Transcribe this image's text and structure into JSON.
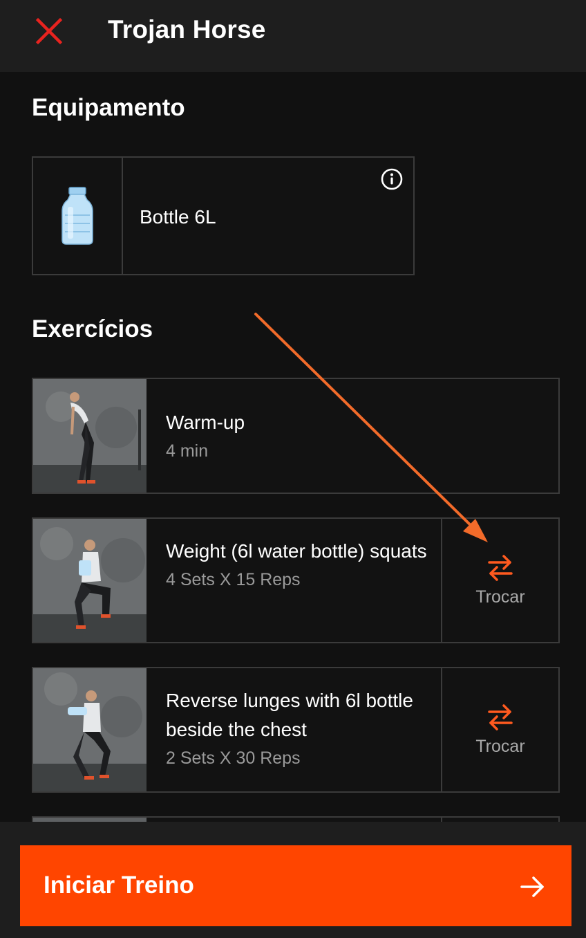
{
  "header": {
    "title": "Trojan Horse",
    "close_icon": "close-icon"
  },
  "equipment": {
    "section_title": "Equipamento",
    "items": [
      {
        "name": "Bottle 6L",
        "image": "water-bottle-image",
        "info_icon": "info-icon"
      }
    ]
  },
  "exercises": {
    "section_title": "Exercícios",
    "items": [
      {
        "name": "Warm-up",
        "meta": "4 min",
        "image": "warm-up-photo"
      },
      {
        "name": "Weight (6l water bottle) squats",
        "meta": "4 Sets X 15 Reps",
        "image": "squat-photo",
        "swap_label": "Trocar",
        "swap_icon": "swap-arrows-icon"
      },
      {
        "name": "Reverse lunges with 6l bottle beside the chest",
        "meta": "2 Sets X 30 Reps",
        "image": "lunge-photo",
        "swap_label": "Trocar",
        "swap_icon": "swap-arrows-icon"
      }
    ]
  },
  "footer": {
    "start_label": "Iniciar Treino",
    "start_icon": "arrow-right-icon"
  },
  "colors": {
    "background": "#111111",
    "header": "#1e1e1e",
    "accent": "#ff4500",
    "swap_icon": "#ff5a1f",
    "close_icon": "#e8231f",
    "annotation_arrow": "#f26b2a",
    "border": "#3b3b3b"
  }
}
